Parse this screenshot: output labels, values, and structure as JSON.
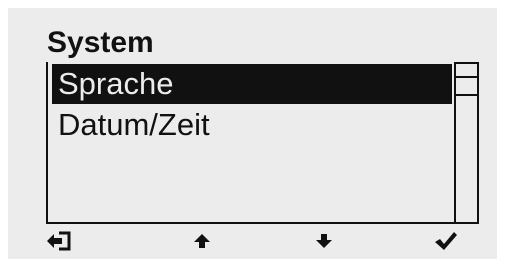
{
  "screen": {
    "title": "System",
    "menu": {
      "items": [
        {
          "label": "Sprache",
          "selected": true
        },
        {
          "label": "Datum/Zeit",
          "selected": false
        }
      ],
      "scrollbar": {
        "visible_fraction": 0.2,
        "position": 0
      }
    },
    "softkeys": [
      {
        "icon": "exit-icon",
        "action": "back"
      },
      {
        "icon": "arrow-up-icon",
        "action": "up"
      },
      {
        "icon": "arrow-down-icon",
        "action": "down"
      },
      {
        "icon": "checkmark-icon",
        "action": "confirm"
      }
    ],
    "colors": {
      "background": "#ececec",
      "foreground": "#111111"
    }
  }
}
